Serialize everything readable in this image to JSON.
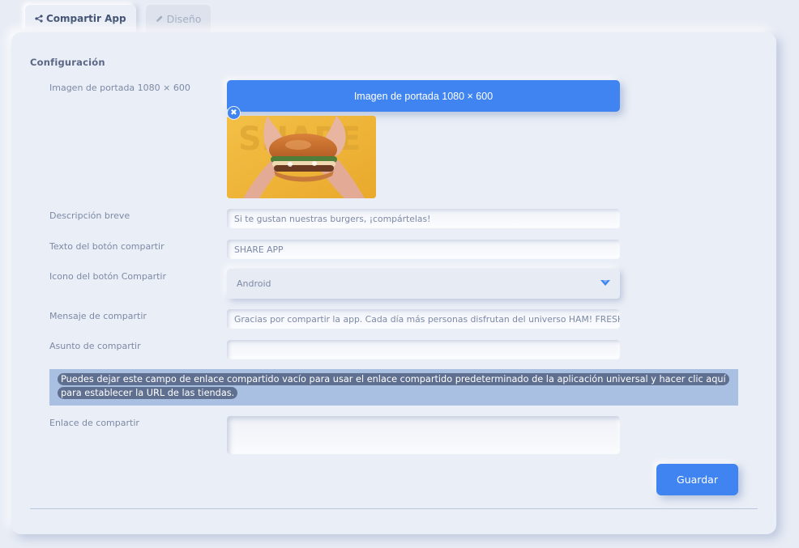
{
  "tabs": [
    {
      "label": "Compartir App",
      "icon": "share-icon",
      "active": true
    },
    {
      "label": "Diseño",
      "icon": "pencil-icon",
      "active": false
    }
  ],
  "section_title": "Configuración",
  "cover": {
    "label": "Imagen de portada 1080 × 600",
    "button_label": "Imagen de portada 1080 × 600",
    "remove_icon": "close-icon",
    "image_subject": "burger",
    "image_watermark": "SHARE"
  },
  "short_description": {
    "label": "Descripción breve",
    "value": "Si te gustan nuestras burgers, ¡compártelas!"
  },
  "share_button_text": {
    "label": "Texto del botón compartir",
    "value": "SHARE APP"
  },
  "share_button_icon": {
    "label": "Icono del botón Compartir",
    "value": "Android",
    "caret_icon": "caret-down-icon"
  },
  "share_message": {
    "label": "Mensaje de compartir",
    "value": "Gracias por compartir la app. Cada día más personas disfrutan del universo HAM! FRESH"
  },
  "share_subject": {
    "label": "Asunto de compartir",
    "value": ""
  },
  "notice": {
    "text": "Puedes dejar este campo de enlace compartido vacío para usar el enlace compartido predeterminado de la aplicación universal y hacer clic aquí para establecer la URL de las tiendas."
  },
  "share_link": {
    "label": "Enlace de compartir",
    "value": ""
  },
  "save_label": "Guardar",
  "colors": {
    "accent": "#3f84f0",
    "background": "#e8ecf5",
    "notice_bg": "#a9c0e3",
    "notice_highlight": "#5f6f90"
  }
}
